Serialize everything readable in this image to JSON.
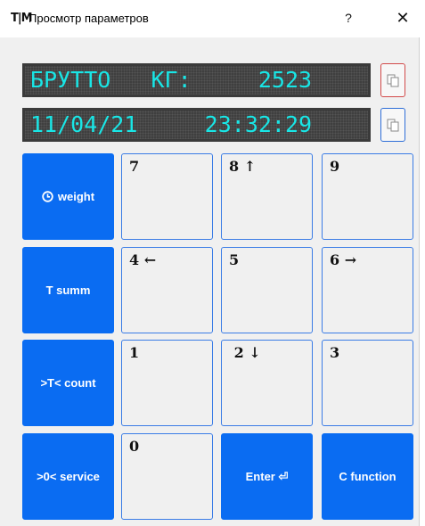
{
  "window": {
    "icon_text": "T|M",
    "title": "Просмотр параметров",
    "help_label": "?",
    "close_label": "✕"
  },
  "displays": {
    "line1": "БРУТТО   КГ:     2523",
    "line2": "11/04/21     23:32:29"
  },
  "colors": {
    "display_text": "#19e6e6",
    "display_bg": "#3f3f3f",
    "key_blue": "#0a6cf2",
    "key_border": "#3a7ce6",
    "copy_border_1": "#d24a4a",
    "copy_border_2": "#2f6fd8"
  },
  "keypad": {
    "fn_weight": "weight",
    "fn_tsumm": "T summ",
    "fn_tcount": ">T< count",
    "fn_service": ">0< service",
    "k7": "7",
    "k8": "8 ↑",
    "k9": "9",
    "k4": "4 ←",
    "k5": "5",
    "k6": "6 →",
    "k1": "1",
    "k2": " 2 ↓",
    "k3": "3",
    "k0": "0",
    "enter": "Enter ⏎",
    "cfunction": "C function"
  },
  "icons": {
    "weight_key": "clock-icon",
    "copy_buttons": "copy-icon"
  }
}
